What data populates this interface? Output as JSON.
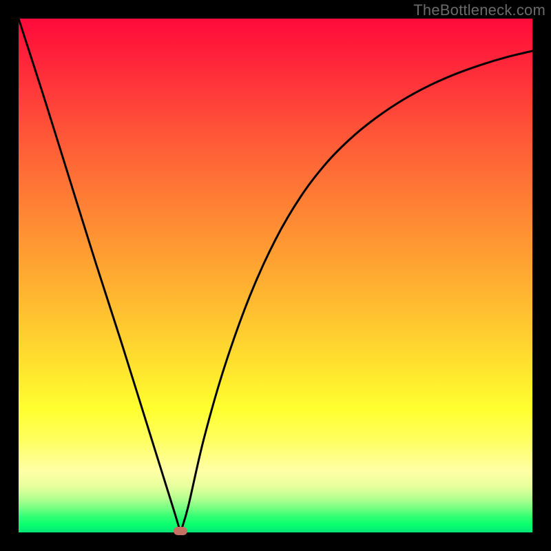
{
  "watermark": "TheBottleneck.com",
  "colors": {
    "frame": "#000000",
    "curve": "#000000",
    "marker": "#c57264",
    "watermark_text": "#6a6a6a"
  },
  "chart_data": {
    "type": "line",
    "title": "",
    "xlabel": "",
    "ylabel": "",
    "xlim": [
      0,
      100
    ],
    "ylim": [
      0,
      100
    ],
    "series": [
      {
        "name": "bottleneck-curve",
        "x": [
          0,
          5,
          10,
          15,
          20,
          25,
          30,
          31.5,
          33,
          36,
          40,
          45,
          50,
          55,
          60,
          65,
          70,
          75,
          80,
          85,
          90,
          95,
          100
        ],
        "values": [
          100,
          84.5,
          68.5,
          52.5,
          37,
          21,
          5,
          0,
          5,
          18,
          32,
          46,
          57,
          65.5,
          72,
          77,
          81,
          84.3,
          87,
          89.2,
          91,
          92.5,
          93.7
        ]
      }
    ],
    "annotations": {
      "vertex": {
        "x": 31.5,
        "y": 0
      }
    }
  }
}
